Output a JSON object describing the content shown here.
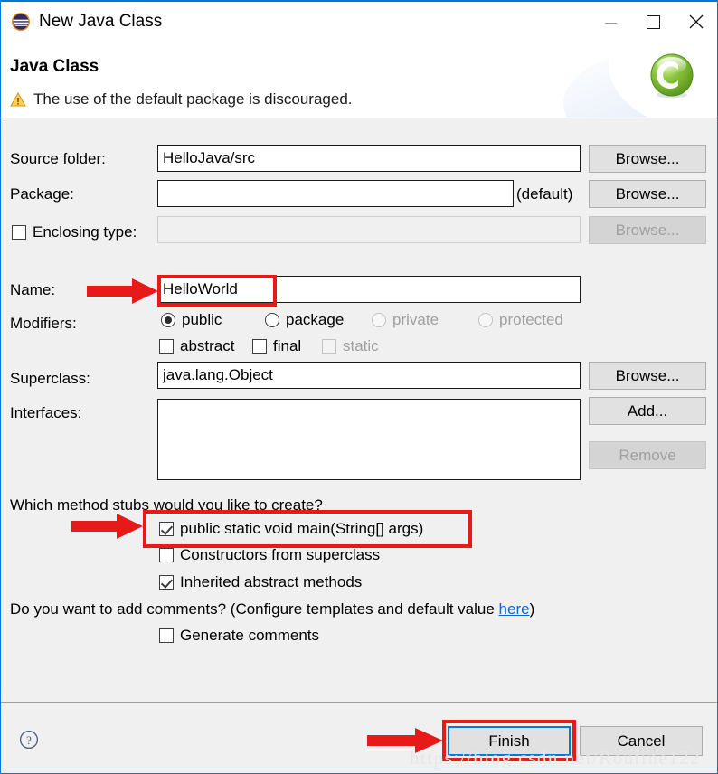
{
  "window": {
    "title": "New Java Class",
    "icon": "eclipse-icon",
    "minimize_label": "Minimize",
    "maximize_label": "Maximize",
    "close_label": "Close"
  },
  "header": {
    "title": "Java Class",
    "message": "The use of the default package is discouraged.",
    "warning_icon": "warning-icon",
    "banner_icon": "java-class-wizard-icon"
  },
  "form": {
    "source_folder": {
      "label": "Source folder:",
      "value": "HelloJava/src",
      "browse_label": "Browse..."
    },
    "package": {
      "label": "Package:",
      "value": "",
      "suffix": "(default)",
      "browse_label": "Browse..."
    },
    "enclosing_type": {
      "label": "Enclosing type:",
      "value": "",
      "checked": false,
      "browse_label": "Browse..."
    },
    "name": {
      "label": "Name:",
      "value": "HelloWorld"
    },
    "modifiers": {
      "label": "Modifiers:",
      "access": [
        {
          "label": "public",
          "selected": true,
          "enabled": true
        },
        {
          "label": "package",
          "selected": false,
          "enabled": true
        },
        {
          "label": "private",
          "selected": false,
          "enabled": false
        },
        {
          "label": "protected",
          "selected": false,
          "enabled": false
        }
      ],
      "flags": [
        {
          "label": "abstract",
          "checked": false,
          "enabled": true
        },
        {
          "label": "final",
          "checked": false,
          "enabled": true
        },
        {
          "label": "static",
          "checked": false,
          "enabled": false
        }
      ]
    },
    "superclass": {
      "label": "Superclass:",
      "value": "java.lang.Object",
      "browse_label": "Browse..."
    },
    "interfaces": {
      "label": "Interfaces:",
      "items": [],
      "add_label": "Add...",
      "remove_label": "Remove"
    },
    "stubs": {
      "question": "Which method stubs would you like to create?",
      "options": [
        {
          "label": "public static void main(String[] args)",
          "checked": true
        },
        {
          "label": "Constructors from superclass",
          "checked": false
        },
        {
          "label": "Inherited abstract methods",
          "checked": true
        }
      ]
    },
    "comments": {
      "question_before": "Do you want to add comments? (Configure templates and default value ",
      "link": "here",
      "question_after": ")",
      "generate": {
        "label": "Generate comments",
        "checked": false
      }
    }
  },
  "footer": {
    "help_icon": "help-icon",
    "finish_label": "Finish",
    "cancel_label": "Cancel"
  },
  "annotations": {
    "watermark": "https://blog.csdn.net/Routine122",
    "accent_color": "#e81919",
    "focus_color": "#0078d7"
  }
}
